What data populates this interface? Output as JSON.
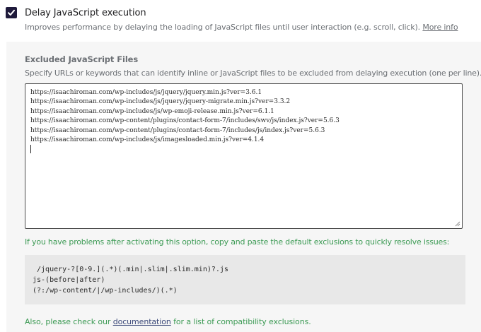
{
  "option": {
    "checked": true,
    "title": "Delay JavaScript execution",
    "description": "Improves performance by delaying the loading of JavaScript files until user interaction (e.g. scroll, click).",
    "more_info_link": "More info"
  },
  "excluded": {
    "title": "Excluded JavaScript Files",
    "description": "Specify URLs or keywords that can identify inline or JavaScript files to be excluded from delaying execution (one per line).",
    "lines": [
      "https://isaachiroman.com/wp-includes/js/jquery/jquery.min.js?ver=3.6.1",
      "https://isaachiroman.com/wp-includes/js/jquery/jquery-migrate.min.js?ver=3.3.2",
      "https://isaachiroman.com/wp-includes/js/wp-emoji-release.min.js?ver=6.1.1",
      "https://isaachiroman.com/wp-content/plugins/contact-form-7/includes/swv/js/index.js?ver=5.6.3",
      "https://isaachiroman.com/wp-content/plugins/contact-form-7/includes/js/index.js?ver=5.6.3",
      "https://isaachiroman.com/wp-includes/js/imagesloaded.min.js?ver=4.1.4"
    ]
  },
  "problems_note": "If you have problems after activating this option, copy and paste the default exclusions to quickly resolve issues:",
  "default_exclusions": [
    " /jquery-?[0-9.](.*)(.min|.slim|.slim.min)?.js",
    "js-(before|after)",
    "(?:/wp-content/|/wp-includes/)(.*)"
  ],
  "footer": {
    "prefix": "Also, please check our",
    "link": "documentation",
    "suffix": "for a list of compatibility exclusions."
  },
  "colors": {
    "checkbox": "#1f1a3b",
    "green_text": "#3c9a54",
    "link": "#3c4a7a"
  }
}
